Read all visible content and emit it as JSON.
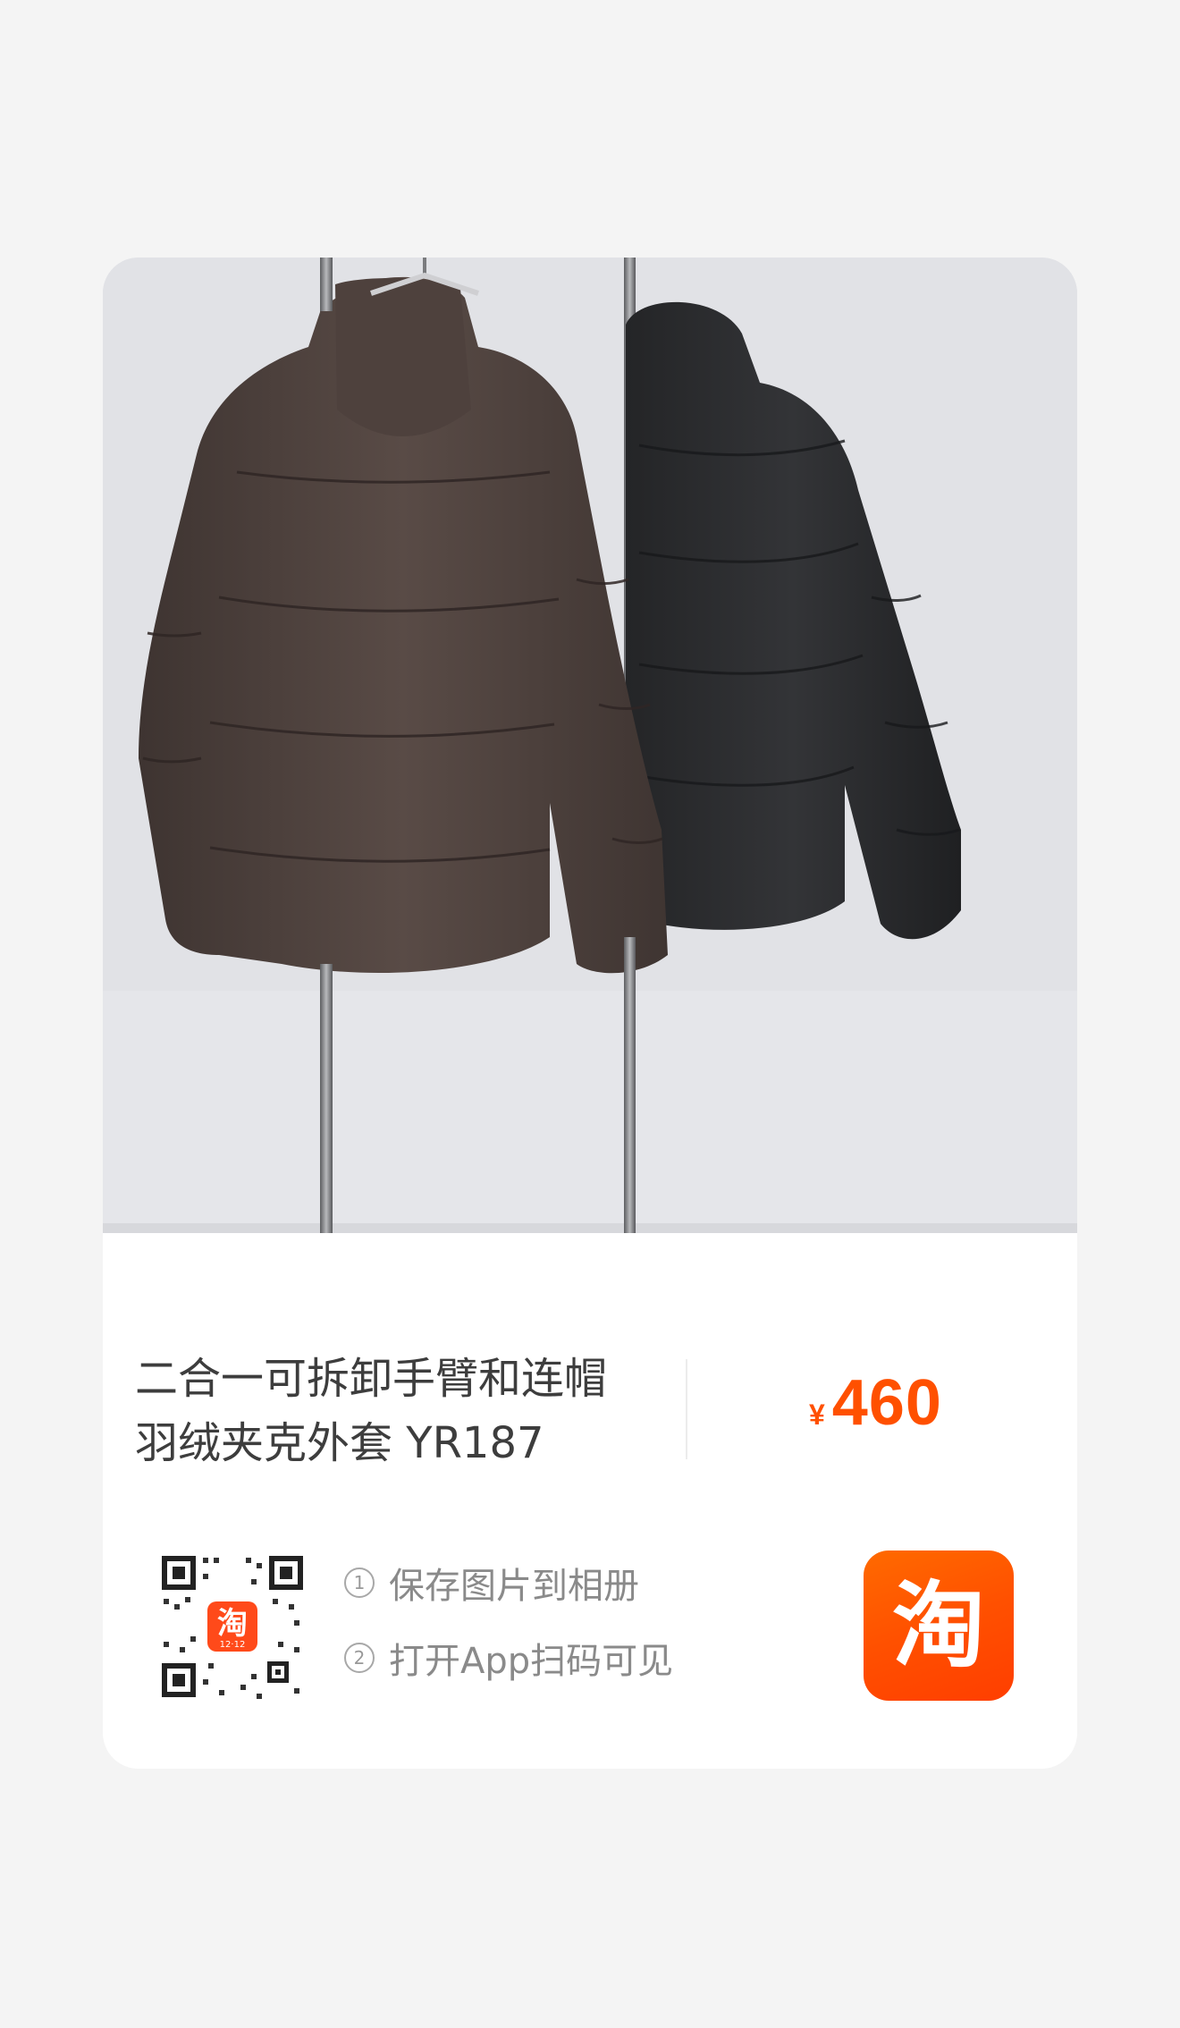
{
  "product": {
    "title_line1": "二合一可拆卸手臂和连帽",
    "title_line2": "羽绒夹克外套 YR187",
    "price_currency": "¥",
    "price_amount": "460",
    "price_color": "#ff5000"
  },
  "share": {
    "step1_num": "1",
    "step1_text": "保存图片到相册",
    "step2_num": "2",
    "step2_text": "打开App扫码可见"
  },
  "app_logo": {
    "glyph": "淘",
    "qr_badge_text": "12·12",
    "color": "#ff5000"
  },
  "icons": {
    "qr": "qr-code-icon",
    "logo": "taobao-logo-icon"
  }
}
